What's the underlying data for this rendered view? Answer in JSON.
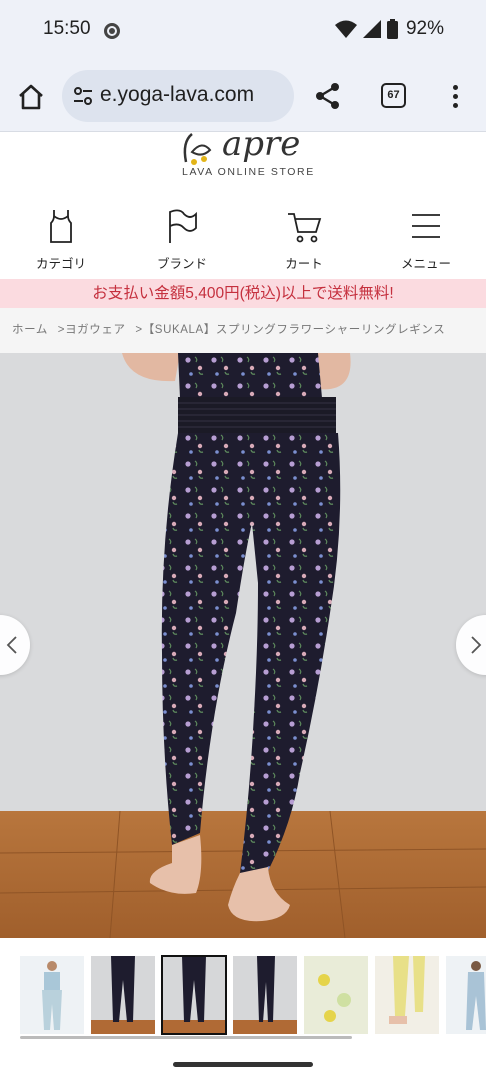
{
  "status_bar": {
    "time": "15:50",
    "battery": "92%",
    "icons": [
      "chrome-icon",
      "wifi-icon",
      "signal-icon",
      "battery-icon"
    ]
  },
  "browser": {
    "url": "e.yoga-lava.com",
    "tab_count": "67",
    "icons": [
      "home-icon",
      "site-settings-icon",
      "share-icon",
      "tab-switcher-icon",
      "more-vert-icon"
    ]
  },
  "site": {
    "logo_text": "apre",
    "logo_subtitle": "LAVA ONLINE STORE",
    "nav": [
      {
        "label": "カテゴリ",
        "icon": "tank-top-icon"
      },
      {
        "label": "ブランド",
        "icon": "flag-icon"
      },
      {
        "label": "カート",
        "icon": "cart-icon"
      },
      {
        "label": "メニュー",
        "icon": "menu-icon"
      }
    ],
    "promo": "お支払い金額5,400円(税込)以上で送料無料!",
    "breadcrumb": [
      "ホーム",
      ">ヨガウェア",
      ">【SUKALA】スプリングフラワーシャーリングレギンス"
    ]
  },
  "gallery": {
    "prev_icon": "chevron-left-icon",
    "next_icon": "chevron-right-icon",
    "thumbnail_count": 7,
    "selected_index": 2
  },
  "colors": {
    "chrome_bg": "#eef1f8",
    "promo_bg": "#fbdbe0",
    "promo_text": "#c5303e",
    "legging": "#1e1c2e"
  }
}
